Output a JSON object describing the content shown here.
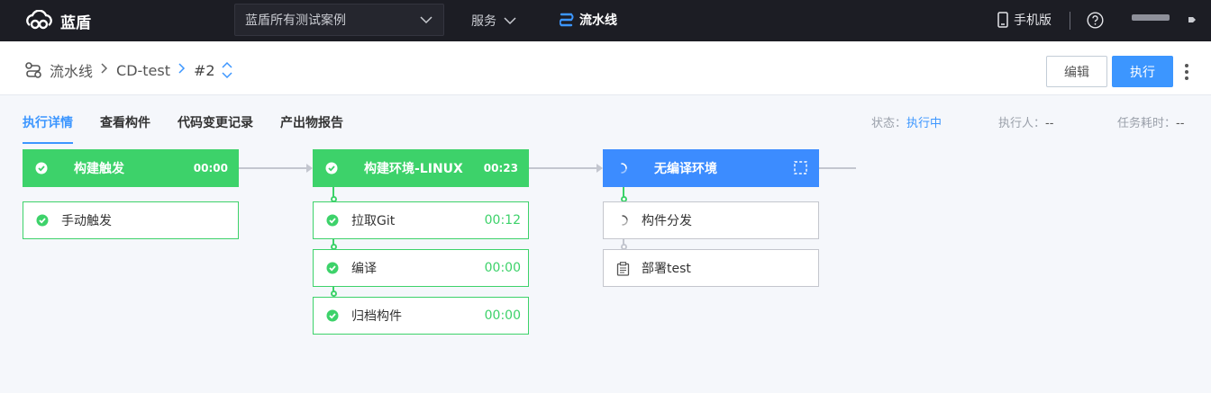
{
  "topbar": {
    "logo_text": "蓝盾",
    "project_select": "蓝盾所有测试案例",
    "service_label": "服务",
    "pipeline_label": "流水线",
    "mobile_label": "手机版"
  },
  "breadcrumb": {
    "pipeline": "流水线",
    "name": "CD-test",
    "build": "#2"
  },
  "header": {
    "edit_label": "编辑",
    "run_label": "执行"
  },
  "tabs": [
    "执行详情",
    "查看构件",
    "代码变更记录",
    "产出物报告"
  ],
  "meta": {
    "status_label": "状态：",
    "status_value": "执行中",
    "executor_label": "执行人：",
    "executor_value": "--",
    "duration_label": "任务耗时：",
    "duration_value": "--"
  },
  "stages": [
    {
      "title": "构建触发",
      "time": "00:00",
      "status": "success",
      "jobs": [
        {
          "name": "手动触发",
          "time": "",
          "status": "success"
        }
      ]
    },
    {
      "title": "构建环境-LINUX",
      "time": "00:23",
      "status": "success",
      "jobs": [
        {
          "name": "拉取Git",
          "time": "00:12",
          "status": "success"
        },
        {
          "name": "编译",
          "time": "00:00",
          "status": "success"
        },
        {
          "name": "归档构件",
          "time": "00:00",
          "status": "success"
        }
      ]
    },
    {
      "title": "无编译环境",
      "time": "",
      "status": "running",
      "jobs": [
        {
          "name": "构件分发",
          "time": "",
          "status": "running"
        },
        {
          "name": "部署test",
          "time": "",
          "status": "pending"
        }
      ]
    }
  ],
  "colors": {
    "topbar": "#1c1d24",
    "accent": "#3c96ff",
    "success": "#3dd26a",
    "running": "#3c8cff"
  }
}
